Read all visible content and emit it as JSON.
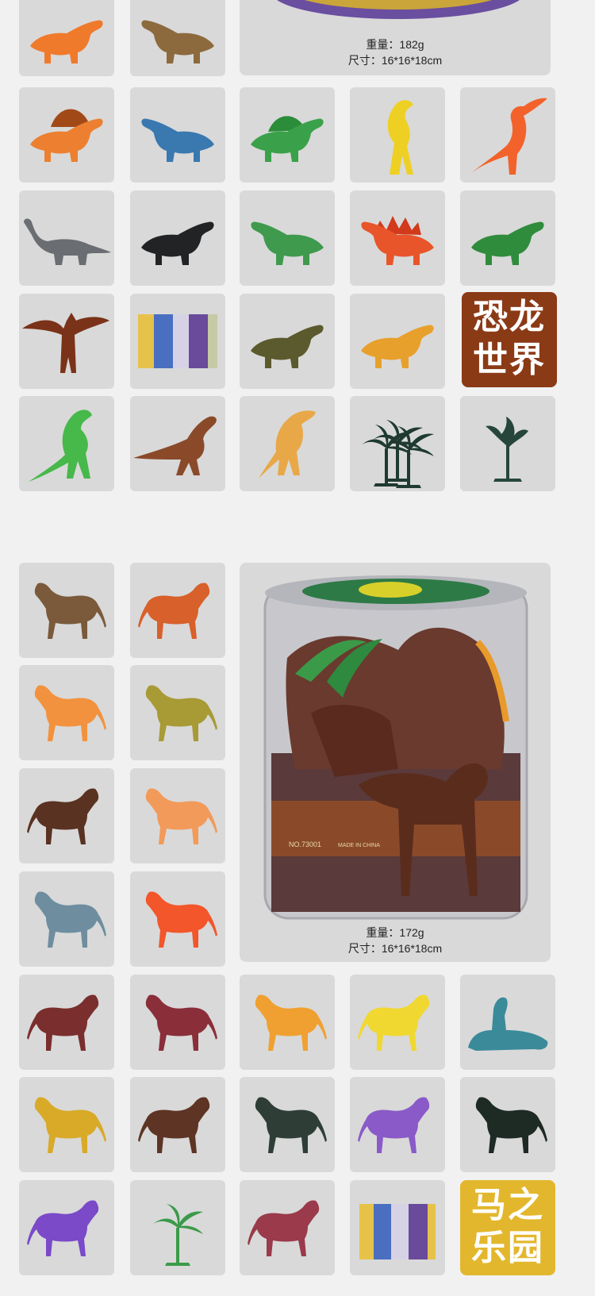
{
  "dino_set": {
    "weight": "重量：182g",
    "size": "尺寸：16*16*18cm",
    "title_line1": "恐龙",
    "title_line2": "世界"
  },
  "horse_set": {
    "weight": "重量：172g",
    "size": "尺寸：16*16*18cm",
    "title_line1": "马之",
    "title_line2": "乐园",
    "bucket_label": "NO.73001",
    "bucket_origin": "MADE IN CHINA"
  },
  "colors": {
    "page_bg": "#f1f1f1",
    "tile_bg": "#d9d9d9",
    "dino_title_bg": "#8b3a16",
    "horse_title_bg": "#e3b72d"
  },
  "items": {
    "dinosaurs": [
      "orange-dinosaur",
      "brown-ankylosaur",
      "orange-dimetrodon",
      "blue-triceratops",
      "green-dimetrodon",
      "yellow-parasaurolophus",
      "orange-parasaurolophus",
      "gray-brachiosaurus",
      "black-dinosaur",
      "green-raptor",
      "red-stegosaurus",
      "green-tyrannosaur",
      "brown-pterodactyl",
      "paper-backdrop",
      "olive-dinosaur",
      "orange-dinosaur-2",
      "green-trex",
      "brown-velociraptor",
      "tan-dinosaur",
      "palm-tree",
      "tree"
    ],
    "horses": [
      "brown-horse",
      "orange-horse",
      "orange-horse-2",
      "olive-horse",
      "dark-brown-horse",
      "orange-pony",
      "blue-gray-horse",
      "orange-red-horse",
      "maroon-horse",
      "maroon-horse-2",
      "orange-horse-3",
      "yellow-horse",
      "lying-blue-horse",
      "yellow-horse-2",
      "brown-horse-2",
      "dark-green-horse",
      "purple-horse",
      "black-horse",
      "purple-horse-2",
      "palm-tree",
      "maroon-horse-3",
      "paper-backdrop"
    ]
  }
}
